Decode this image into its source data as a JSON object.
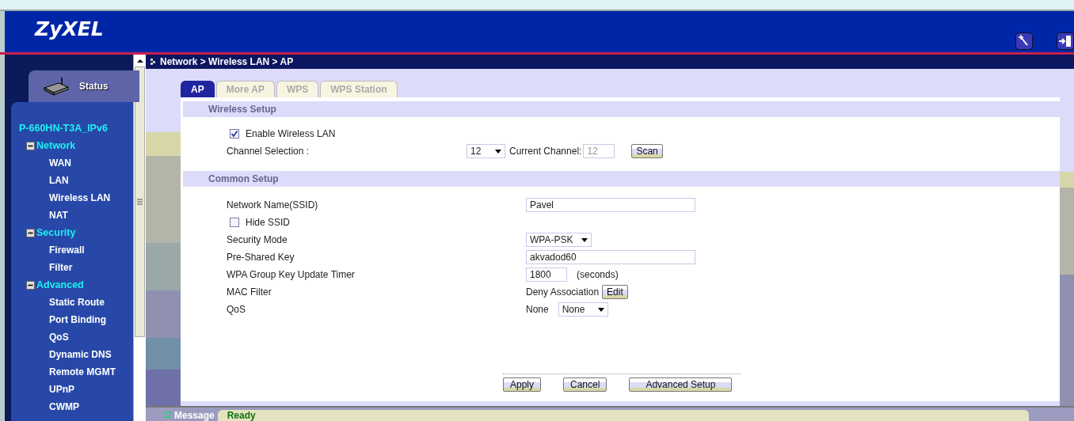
{
  "header": {
    "logo": "ZyXEL"
  },
  "sidebar": {
    "status_label": "Status",
    "device": "P-660HN-T3A_IPv6",
    "groups": [
      {
        "label": "Network",
        "expanded": true,
        "children": [
          {
            "label": "WAN"
          },
          {
            "label": "LAN"
          },
          {
            "label": "Wireless LAN"
          },
          {
            "label": "NAT"
          }
        ]
      },
      {
        "label": "Security",
        "expanded": true,
        "children": [
          {
            "label": "Firewall"
          },
          {
            "label": "Filter"
          }
        ]
      },
      {
        "label": "Advanced",
        "expanded": true,
        "children": [
          {
            "label": "Static Route"
          },
          {
            "label": "Port Binding"
          },
          {
            "label": "QoS"
          },
          {
            "label": "Dynamic DNS"
          },
          {
            "label": "Remote MGMT"
          },
          {
            "label": "UPnP"
          },
          {
            "label": "CWMP"
          }
        ]
      }
    ]
  },
  "breadcrumb": "Network > Wireless LAN > AP",
  "tabs": [
    {
      "label": "AP",
      "selected": true
    },
    {
      "label": "More AP",
      "selected": false
    },
    {
      "label": "WPS",
      "selected": false
    },
    {
      "label": "WPS Station",
      "selected": false
    }
  ],
  "wireless_setup": {
    "title": "Wireless Setup",
    "enable": {
      "label": "Enable Wireless LAN",
      "checked": true
    },
    "channel": {
      "label": "Channel Selection :",
      "value": "12",
      "current_label": "Current Channel:",
      "current_value": "12",
      "scan": "Scan"
    }
  },
  "common_setup": {
    "title": "Common Setup",
    "rows": [
      {
        "kind": "text",
        "label": "Network Name(SSID)",
        "value": "Pavel"
      },
      {
        "kind": "checkbox",
        "label": "Hide SSID",
        "checked": false
      },
      {
        "kind": "select",
        "label": "Security Mode",
        "value": "WPA-PSK"
      },
      {
        "kind": "text",
        "label": "Pre-Shared Key",
        "value": "akvadod60"
      },
      {
        "kind": "timer",
        "label": "WPA Group Key Update Timer",
        "value": "1800",
        "unit": "(seconds)"
      },
      {
        "kind": "action",
        "label": "MAC Filter",
        "text": "Deny Association",
        "button": "Edit"
      },
      {
        "kind": "textselect",
        "label": "QoS",
        "text": "None",
        "value": "None"
      }
    ]
  },
  "buttons": [
    "Apply",
    "Cancel",
    "Advanced Setup"
  ],
  "message": {
    "label": "Message",
    "status": "Ready"
  }
}
